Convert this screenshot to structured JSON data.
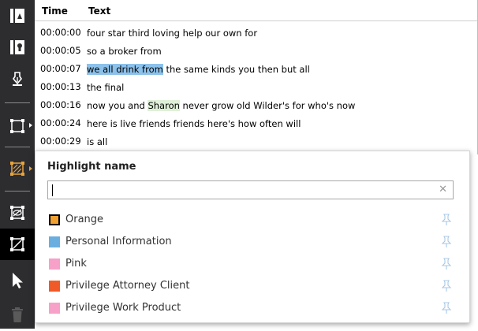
{
  "toolbar": {
    "icons": [
      "panel-left-icon",
      "panel-dark-icon",
      "pen-nib-icon",
      "redact-region-icon",
      "highlight-region-icon",
      "hide-region-icon",
      "redact-select-icon",
      "pointer-icon",
      "trash-icon"
    ],
    "selected_tool_color": "#e8a33c"
  },
  "transcript": {
    "headers": {
      "time": "Time",
      "text": "Text"
    },
    "rows": [
      {
        "time": "00:00:00",
        "pre": "four star third loving help our own for",
        "mark": "",
        "post": ""
      },
      {
        "time": "00:00:05",
        "pre": "so a broker from",
        "mark": "",
        "post": ""
      },
      {
        "time": "00:00:07",
        "pre": "",
        "mark": "we all drink from",
        "post": " the same kinds you then but all"
      },
      {
        "time": "00:00:13",
        "pre": "the final",
        "mark": "",
        "post": ""
      },
      {
        "time": "00:00:16",
        "pre": "now you and ",
        "mark": "Sharon",
        "post": " never grow old Wilder's for who's now"
      },
      {
        "time": "00:00:24",
        "pre": "here is live friends friends here's how often will",
        "mark": "",
        "post": ""
      },
      {
        "time": "00:00:29",
        "pre": "is all",
        "mark": "",
        "post": ""
      }
    ]
  },
  "popup": {
    "title": "Highlight name",
    "search": {
      "value": "",
      "placeholder": ""
    },
    "clear_icon": "close-icon",
    "items": [
      {
        "label": "Orange",
        "color": "#f0a030",
        "border": "#000000"
      },
      {
        "label": "Personal Information",
        "color": "#6aaee0",
        "border": "#6aaee0"
      },
      {
        "label": "Pink",
        "color": "#f7a0c8",
        "border": "#f7a0c8"
      },
      {
        "label": "Privilege Attorney Client",
        "color": "#f05a28",
        "border": "#f05a28"
      },
      {
        "label": "Privilege Work Product",
        "color": "#f7a0c8",
        "border": "#f7a0c8"
      }
    ]
  }
}
